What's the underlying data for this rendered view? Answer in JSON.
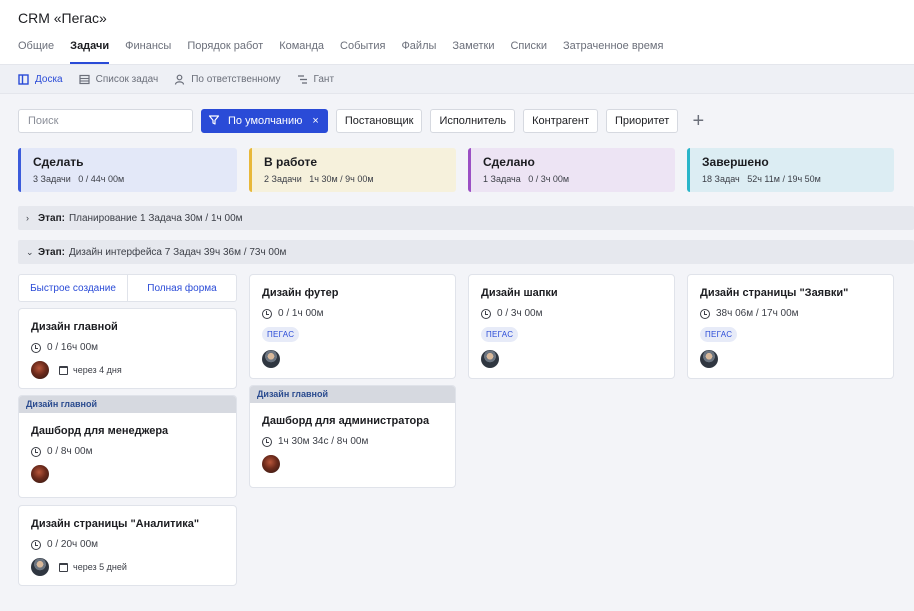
{
  "app": {
    "title": "CRM «Пегас»"
  },
  "tabs": [
    "Общие",
    "Задачи",
    "Финансы",
    "Порядок работ",
    "Команда",
    "События",
    "Файлы",
    "Заметки",
    "Списки",
    "Затраченное время"
  ],
  "active_tab": "Задачи",
  "views": [
    {
      "label": "Доска",
      "icon": "board-icon",
      "active": true
    },
    {
      "label": "Список задач",
      "icon": "list-icon",
      "active": false
    },
    {
      "label": "По ответственному",
      "icon": "user-icon",
      "active": false
    },
    {
      "label": "Гант",
      "icon": "gantt-icon",
      "active": false
    }
  ],
  "filters": {
    "search_placeholder": "Поиск",
    "default_label": "По умолчанию",
    "default_clear": "×",
    "chips": [
      "Постановщик",
      "Исполнитель",
      "Контрагент",
      "Приоритет"
    ],
    "add": "+"
  },
  "columns": [
    {
      "name": "Сделать",
      "count": "3 Задачи",
      "time": "0 / 44ч 00м",
      "bg": "#e3e8f8",
      "accent": "#3b5bdb"
    },
    {
      "name": "В работе",
      "count": "2 Задачи",
      "time": "1ч 30м / 9ч 00м",
      "bg": "#f6f1dc",
      "accent": "#e8b83a"
    },
    {
      "name": "Сделано",
      "count": "1 Задача",
      "time": "0 / 3ч 00м",
      "bg": "#ede4f4",
      "accent": "#9b4fc4"
    },
    {
      "name": "Завершено",
      "count": "18 Задач",
      "time": "52ч 11м / 19ч 50м",
      "bg": "#dcedf3",
      "accent": "#2bb5c9"
    }
  ],
  "stages": [
    {
      "chevron": "›",
      "label": "Этап:",
      "name": "Планирование",
      "count": "1 Задача",
      "time": "30м / 1ч 00м"
    },
    {
      "chevron": "⌄",
      "label": "Этап:",
      "name": "Дизайн интерфейса",
      "count": "7 Задач",
      "time": "39ч 36м / 73ч 00м"
    }
  ],
  "quick": {
    "create": "Быстрое создание",
    "full": "Полная форма"
  },
  "cards": [
    {
      "title": "Дизайн главной",
      "time": "0 / 16ч 00м",
      "due": "через 4 дня",
      "avatar": "red"
    },
    {
      "parent": "Дизайн главной",
      "title": "Дашборд для менеджера",
      "time": "0 / 8ч 00м",
      "avatar": "red"
    },
    {
      "title": "Дизайн страницы \"Аналитика\"",
      "time": "0 / 20ч 00м",
      "due": "через 5 дней",
      "avatar": "man"
    },
    {
      "title": "Дизайн футер",
      "time": "0 / 1ч 00м",
      "tag": "ПЕГАС",
      "avatar": "man"
    },
    {
      "parent": "Дизайн главной",
      "title": "Дашборд для администратора",
      "time": "1ч 30м 34с / 8ч 00м",
      "avatar": "red"
    },
    {
      "title": "Дизайн шапки",
      "time": "0 / 3ч 00м",
      "tag": "ПЕГАС",
      "avatar": "man"
    },
    {
      "title": "Дизайн страницы \"Заявки\"",
      "time": "38ч 06м  / 17ч 00м",
      "tag": "ПЕГАС",
      "avatar": "man"
    }
  ]
}
